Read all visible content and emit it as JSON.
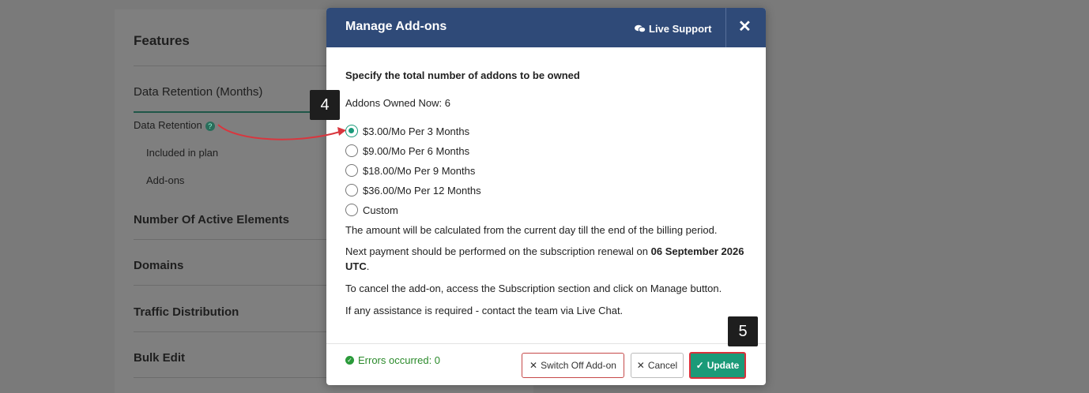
{
  "background": {
    "title": "Features",
    "sections": [
      {
        "label": "Data Retention (Months)"
      },
      {
        "label": "Number Of Active Elements"
      },
      {
        "label": "Domains"
      },
      {
        "label": "Traffic Distribution"
      },
      {
        "label": "Bulk Edit"
      }
    ],
    "data_retention_label": "Data Retention",
    "included_label": "Included in plan",
    "addons_label": "Add-ons"
  },
  "modal": {
    "title": "Manage Add-ons",
    "live_support": "Live Support",
    "close": "✕",
    "specify": "Specify the total number of addons to be owned",
    "owned_now": "Addons Owned Now: 6",
    "options": [
      {
        "label": "$3.00/Mo Per 3 Months",
        "checked": true
      },
      {
        "label": "$9.00/Mo Per 6 Months",
        "checked": false
      },
      {
        "label": "$18.00/Mo Per 9 Months",
        "checked": false
      },
      {
        "label": "$36.00/Mo Per 12 Months",
        "checked": false
      },
      {
        "label": "Custom",
        "checked": false
      }
    ],
    "note_amount": "The amount will be calculated from the current day till the end of the billing period.",
    "note_next_payment_prefix": "Next payment should be performed on the subscription renewal on ",
    "note_next_payment_date": "06 September 2026 UTC",
    "note_next_payment_suffix": ".",
    "note_cancel": "To cancel the add-on, access the Subscription section and click on Manage button.",
    "note_assist": "If any assistance is required - contact the team via Live Chat.",
    "errors": "Errors occurred: 0",
    "switch_off": "Switch Off Add-on",
    "cancel": "Cancel",
    "update": "Update"
  },
  "annotations": {
    "step4": "4",
    "step5": "5"
  },
  "colors": {
    "header": "#2f4a78",
    "accent": "#1b9a78",
    "danger": "#d9303a"
  }
}
